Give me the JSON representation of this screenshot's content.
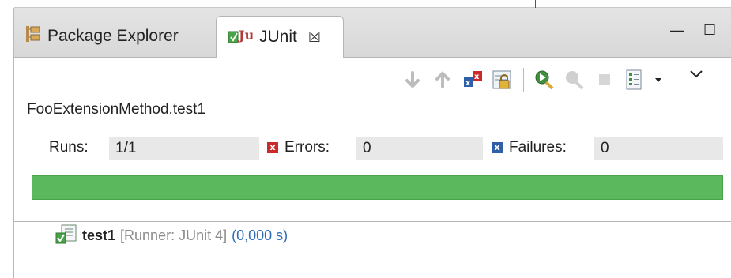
{
  "tabs": [
    {
      "label": "Package Explorer",
      "icon": "package-explorer-icon"
    },
    {
      "label": "JUnit",
      "icon": "junit-icon"
    }
  ],
  "close_glyph": "☒",
  "view_controls": {
    "minimize": "—",
    "maximize": "☐"
  },
  "toolbar": [
    "next-failure-icon",
    "previous-failure-icon",
    "show-failures-only-icon",
    "scroll-lock-icon",
    "rerun-test-icon",
    "rerun-failed-first-icon",
    "stop-icon",
    "history-icon",
    "view-menu-icon"
  ],
  "test_title": "FooExtensionMethod.test1",
  "stats": {
    "runs_label": "Runs:",
    "runs_value": "1/1",
    "errors_label": "Errors:",
    "errors_value": "0",
    "failures_label": "Failures:",
    "failures_value": "0"
  },
  "progress": {
    "fraction": 1.0,
    "color": "#5cb85c"
  },
  "tree": [
    {
      "name": "test1",
      "runner": "[Runner: JUnit 4]",
      "time": "(0,000 s)"
    }
  ]
}
